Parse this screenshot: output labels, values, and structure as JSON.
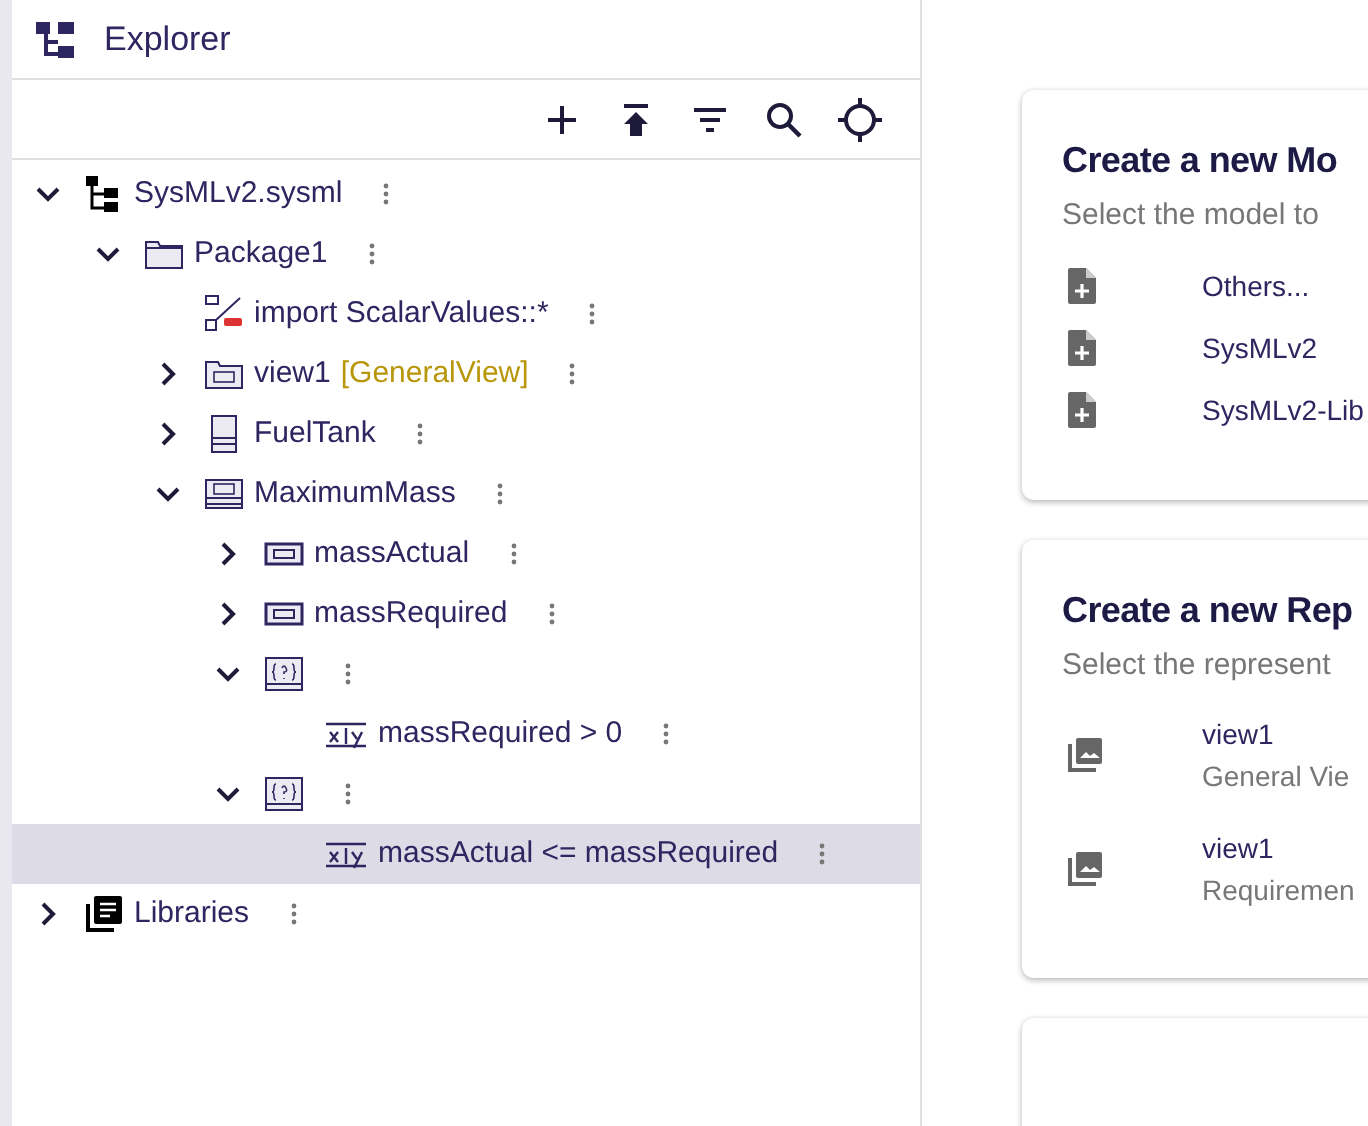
{
  "explorer": {
    "title": "Explorer"
  },
  "tree": [
    {
      "label": "SysMLv2.sysml",
      "kind": "model",
      "expanded": true,
      "selected": false,
      "children": [
        {
          "label": "Package1",
          "kind": "package",
          "expanded": true,
          "selected": false,
          "children": [
            {
              "label": "import ScalarValues::*",
              "kind": "import",
              "selected": false
            },
            {
              "label": "view1",
              "suffix": "[GeneralView]",
              "kind": "view",
              "expanded": false,
              "selected": false
            },
            {
              "label": "FuelTank",
              "kind": "part",
              "expanded": false,
              "selected": false
            },
            {
              "label": "MaximumMass",
              "kind": "requirement",
              "expanded": true,
              "selected": false,
              "children": [
                {
                  "label": "massActual",
                  "kind": "attribute",
                  "expanded": false,
                  "selected": false
                },
                {
                  "label": "massRequired",
                  "kind": "attribute",
                  "expanded": false,
                  "selected": false
                },
                {
                  "kind": "constraint",
                  "expanded": true,
                  "selected": false,
                  "children": [
                    {
                      "label": "massRequired > 0",
                      "kind": "expression",
                      "selected": false
                    }
                  ]
                },
                {
                  "kind": "constraint",
                  "expanded": true,
                  "selected": false,
                  "children": [
                    {
                      "label": "massActual <= massRequired",
                      "kind": "expression",
                      "selected": true
                    }
                  ]
                }
              ]
            }
          ]
        }
      ]
    },
    {
      "label": "Libraries",
      "kind": "library",
      "expanded": false,
      "selected": false
    }
  ],
  "cards": [
    {
      "title": "Create a new Mo",
      "subtitle": "Select the model to",
      "items": [
        {
          "kind": "model",
          "label": "Others..."
        },
        {
          "kind": "model",
          "label": "SysMLv2"
        },
        {
          "kind": "model",
          "label": "SysMLv2-Lib"
        }
      ]
    },
    {
      "title": "Create a new Rep",
      "subtitle": "Select the represent",
      "items": [
        {
          "kind": "representation",
          "label": "view1",
          "description": "General Vie"
        },
        {
          "kind": "representation",
          "label": "view1",
          "description": "Requiremen"
        }
      ]
    }
  ]
}
